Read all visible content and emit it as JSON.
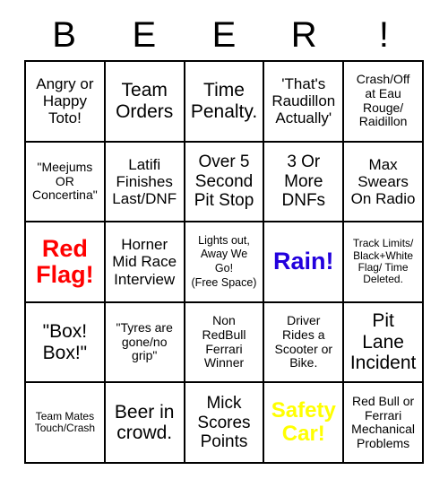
{
  "card": {
    "title_letters": [
      "B",
      "E",
      "E",
      "R",
      "!"
    ],
    "colors": {
      "red": "#ff0000",
      "blue": "#2200dd",
      "yellow": "#ffff00",
      "text": "#000000",
      "grid_line": "#000000",
      "background": "#ffffff"
    },
    "rows": [
      [
        {
          "text": "Angry or\nHappy\nToto!",
          "size": "s-md",
          "style": "plain"
        },
        {
          "text": "Team\nOrders",
          "size": "s-xl",
          "style": "plain"
        },
        {
          "text": "Time\nPenalty.",
          "size": "s-xl",
          "style": "plain"
        },
        {
          "text": "'That's\nRaudillon\nActually'",
          "size": "s-md",
          "style": "plain"
        },
        {
          "text": "Crash/Off\nat Eau\nRouge/\nRaidillon",
          "size": "s-sm",
          "style": "plain"
        }
      ],
      [
        {
          "text": "\"Meejums\nOR\nConcertina\"",
          "size": "s-sm",
          "style": "plain"
        },
        {
          "text": "Latifi\nFinishes\nLast/DNF",
          "size": "s-md",
          "style": "plain"
        },
        {
          "text": "Over 5\nSecond\nPit Stop",
          "size": "s-lg",
          "style": "plain"
        },
        {
          "text": "3 Or\nMore\nDNFs",
          "size": "s-lg",
          "style": "plain"
        },
        {
          "text": "Max\nSwears\nOn Radio",
          "size": "s-md",
          "style": "plain"
        }
      ],
      [
        {
          "text": "Red\nFlag!",
          "size": "s-xl",
          "style": "c-red"
        },
        {
          "text": "Horner\nMid Race\nInterview",
          "size": "s-md",
          "style": "plain"
        },
        {
          "text": "Lights out,\nAway We\nGo!\n(Free Space)",
          "size": "s-xs",
          "style": "free"
        },
        {
          "text": "Rain!",
          "size": "s-xl",
          "style": "c-blue"
        },
        {
          "text": "Track Limits/\nBlack+White\nFlag/ Time\nDeleted.",
          "size": "s-xs",
          "style": "plain"
        }
      ],
      [
        {
          "text": "\"Box!\nBox!\"",
          "size": "s-xl",
          "style": "plain"
        },
        {
          "text": "\"Tyres are\ngone/no\ngrip\"",
          "size": "s-sm",
          "style": "plain"
        },
        {
          "text": "Non\nRedBull\nFerrari\nWinner",
          "size": "s-sm",
          "style": "plain"
        },
        {
          "text": "Driver\nRides a\nScooter or\nBike.",
          "size": "s-sm",
          "style": "plain"
        },
        {
          "text": "Pit\nLane\nIncident",
          "size": "s-xl",
          "style": "plain"
        }
      ],
      [
        {
          "text": "Team Mates\nTouch/Crash",
          "size": "s-xs",
          "style": "plain"
        },
        {
          "text": "Beer in\ncrowd.",
          "size": "s-xl",
          "style": "plain"
        },
        {
          "text": "Mick\nScores\nPoints",
          "size": "s-lg",
          "style": "plain"
        },
        {
          "text": "Safety\nCar!",
          "size": "s-xl",
          "style": "c-yellow"
        },
        {
          "text": "Red Bull or\nFerrari\nMechanical\nProblems",
          "size": "s-sm",
          "style": "plain"
        }
      ]
    ]
  }
}
